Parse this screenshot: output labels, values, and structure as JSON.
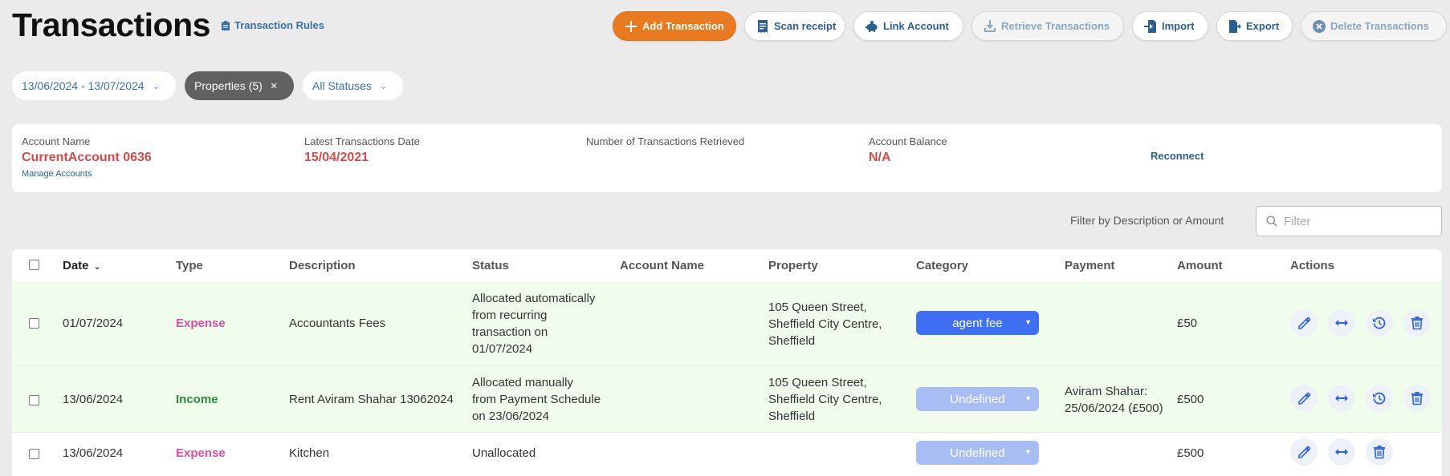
{
  "header": {
    "title": "Transactions",
    "rules_link": "Transaction Rules"
  },
  "toolbar": {
    "add": "Add Transaction",
    "scan": "Scan receipt",
    "link": "Link Account",
    "retrieve": "Retrieve Transactions",
    "import": "Import",
    "export": "Export",
    "delete": "Delete Transactions"
  },
  "filters": {
    "date_range": "13/06/2024 - 13/07/2024",
    "properties": "Properties (5)",
    "statuses": "All Statuses"
  },
  "account": {
    "name_label": "Account Name",
    "name": "CurrentAccount 0636",
    "manage": "Manage Accounts",
    "latest_label": "Latest Transactions Date",
    "latest": "15/04/2021",
    "count_label": "Number of Transactions Retrieved",
    "balance_label": "Account Balance",
    "balance": "N/A",
    "reconnect": "Reconnect"
  },
  "filter": {
    "label": "Filter by Description or Amount",
    "placeholder": "Filter"
  },
  "table": {
    "columns": {
      "date": "Date",
      "type": "Type",
      "description": "Description",
      "status": "Status",
      "account_name": "Account Name",
      "property": "Property",
      "category": "Category",
      "payment": "Payment",
      "amount": "Amount",
      "actions": "Actions"
    },
    "rows": [
      {
        "date": "01/07/2024",
        "type": "Expense",
        "description": "Accountants Fees",
        "status": [
          "Allocated automatically",
          "from recurring",
          "transaction on",
          "01/07/2024"
        ],
        "account_name": "",
        "property": [
          "105 Queen Street,",
          "Sheffield City Centre,",
          "Sheffield"
        ],
        "category": "agent fee",
        "payment": [],
        "amount": "£50"
      },
      {
        "date": "13/06/2024",
        "type": "Income",
        "description": "Rent Aviram Shahar 13062024",
        "status": [
          "Allocated manually",
          "from Payment Schedule",
          "on 23/06/2024"
        ],
        "account_name": "",
        "property": [
          "105 Queen Street,",
          "Sheffield City Centre,",
          "Sheffield"
        ],
        "category": "Undefined",
        "payment": [
          "Aviram Shahar:",
          "25/06/2024 (£500)"
        ],
        "amount": "£500"
      },
      {
        "date": "13/06/2024",
        "type": "Expense",
        "description": "Kitchen",
        "status": [
          "Unallocated"
        ],
        "account_name": "",
        "property": [],
        "category": "Undefined",
        "payment": [],
        "amount": "£500"
      }
    ]
  }
}
